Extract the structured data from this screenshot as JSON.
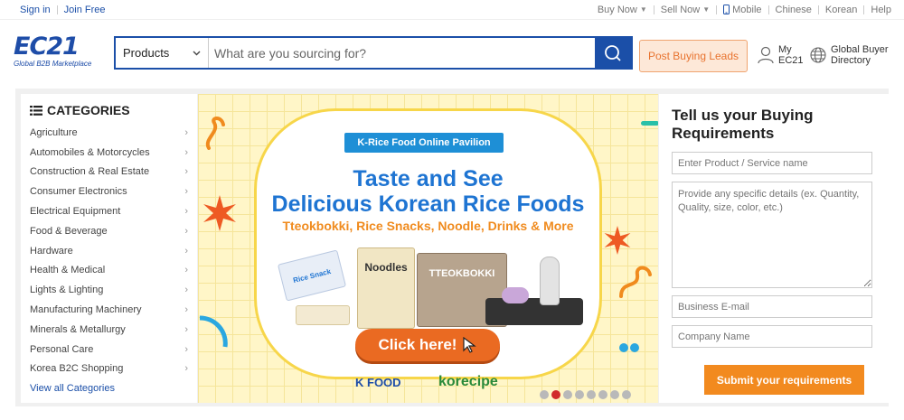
{
  "topbar": {
    "sign_in": "Sign in",
    "join_free": "Join Free",
    "buy_now": "Buy Now",
    "sell_now": "Sell Now",
    "mobile": "Mobile",
    "chinese": "Chinese",
    "korean": "Korean",
    "help": "Help"
  },
  "logo": {
    "mark": "EC21",
    "tagline": "Global B2B Marketplace"
  },
  "search": {
    "category": "Products",
    "placeholder": "What are you sourcing for?"
  },
  "header": {
    "post_buying_leads": "Post Buying Leads",
    "my_ec21_line1": "My",
    "my_ec21_line2": "EC21",
    "directory_line1": "Global Buyer",
    "directory_line2": "Directory"
  },
  "categories": {
    "title": "CATEGORIES",
    "items": [
      "Agriculture",
      "Automobiles & Motorcycles",
      "Construction & Real Estate",
      "Consumer Electronics",
      "Electrical Equipment",
      "Food & Beverage",
      "Hardware",
      "Health & Medical",
      "Lights & Lighting",
      "Manufacturing Machinery",
      "Minerals & Metallurgy",
      "Personal Care",
      "Korea B2C Shopping"
    ],
    "view_all": "View all Categories"
  },
  "banner": {
    "pill": "K-Rice Food Online Pavilion",
    "headline1": "Taste and See",
    "headline2": "Delicious Korean Rice Foods",
    "subline": "Tteokbokki, Rice Snacks, Noodle, Drinks & More",
    "cta": "Click here!",
    "brand1": "K FOOD",
    "brand2": "korecipe",
    "product_noodles": "Noodles",
    "product_tteokbokki": "TTEOKBOKKI",
    "product_snack": "Rice Snack",
    "slide_count": 8,
    "active_slide": 2
  },
  "rfq": {
    "title": "Tell us your Buying Requirements",
    "product_placeholder": "Enter Product / Service name",
    "details_placeholder": "Provide any specific details (ex. Quantity, Quality, size, color, etc.)",
    "email_placeholder": "Business E-mail",
    "company_placeholder": "Company Name",
    "submit": "Submit your requirements"
  },
  "colors": {
    "brand_blue": "#1b4fa8",
    "accent_orange": "#f28a1f",
    "active_dot": "#d12b2b"
  }
}
